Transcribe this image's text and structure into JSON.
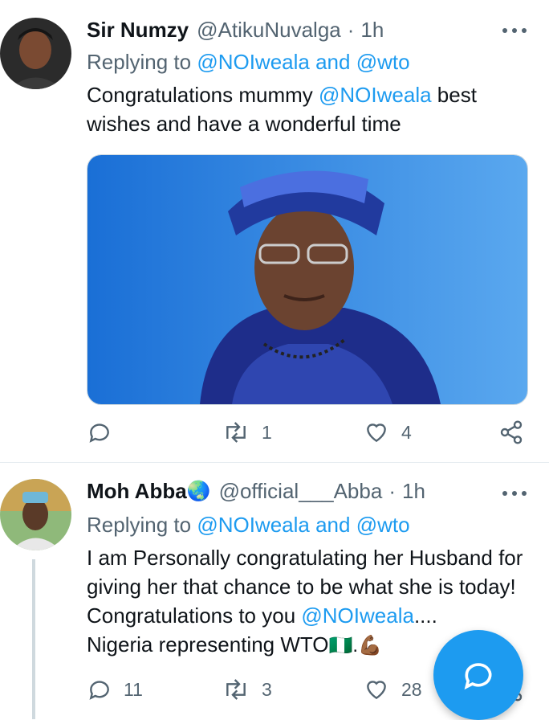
{
  "tweets": [
    {
      "display_name": "Sir Numzy",
      "handle": "@AtikuNuvalga",
      "dot": "·",
      "time": "1h",
      "replying_prefix": "Replying to",
      "replying_mentions": "@NOIweala and @wto",
      "text_part1": "Congratulations mummy ",
      "text_mention": "@NOIweala",
      "text_part2": "  best wishes and have a wonderful time",
      "reply_count": "",
      "retweet_count": "1",
      "like_count": "4"
    },
    {
      "display_name": "Moh Abba",
      "name_emoji": "🌏",
      "handle": "@official___Abba",
      "dot": "·",
      "time": "1h",
      "replying_prefix": "Replying to",
      "replying_mentions": "@NOIweala and @wto",
      "text_part1": "I am Personally congratulating her Husband for giving her that chance to be what she is today! Congratulations to you ",
      "text_mention": "@NOIweala",
      "text_part2": "....",
      "text_line4": "Nigeria representing WTO",
      "text_emoji_after": "🇳🇬.💪🏾",
      "reply_count": "11",
      "retweet_count": "3",
      "like_count": "28"
    }
  ],
  "colors": {
    "accent": "#1d9bf0",
    "secondary_text": "#536471",
    "primary_text": "#0f1419"
  },
  "icons": {
    "reply": "reply-icon",
    "retweet": "retweet-icon",
    "like": "heart-icon",
    "share": "share-icon",
    "more": "more-options-icon",
    "compose": "compose-reply-icon"
  }
}
